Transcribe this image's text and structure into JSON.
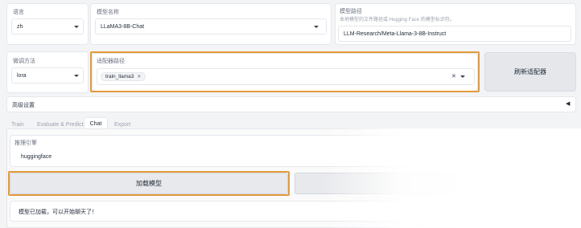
{
  "top_row": {
    "language": {
      "label": "语言",
      "value": "zh"
    },
    "model_name": {
      "label": "模型名称",
      "value": "LLaMA3-8B-Chat"
    },
    "model_path": {
      "label": "模型路径",
      "info": "本地模型的文件路径或 Hugging Face 的模型标识符。",
      "value": "LLM-Research/Meta-Llama-3-8B-Instruct"
    }
  },
  "second_row": {
    "finetune_method": {
      "label": "微调方法",
      "value": "lora"
    },
    "adapter_path": {
      "label": "适配器路径",
      "chips": [
        "train_llama3"
      ]
    },
    "refresh_adapter_label": "刷新适配器"
  },
  "advanced": {
    "label": "高级设置",
    "arrow": "◀"
  },
  "tabs": [
    "Train",
    "Evaluate & Predict",
    "Chat",
    "Export"
  ],
  "active_tab": "Chat",
  "chat": {
    "infer_backend": {
      "label": "推理引擎",
      "value": "huggingface"
    },
    "load_model_label": "加载模型",
    "status_text": "模型已加载，可以开始聊天了！"
  },
  "colors": {
    "highlight": "#e39a3b",
    "background": "#f3f4f6",
    "button": "#e5e7eb"
  },
  "icons": [
    "chevron-down-icon",
    "clear-icon",
    "chip-close-icon",
    "collapse-arrow-icon"
  ]
}
